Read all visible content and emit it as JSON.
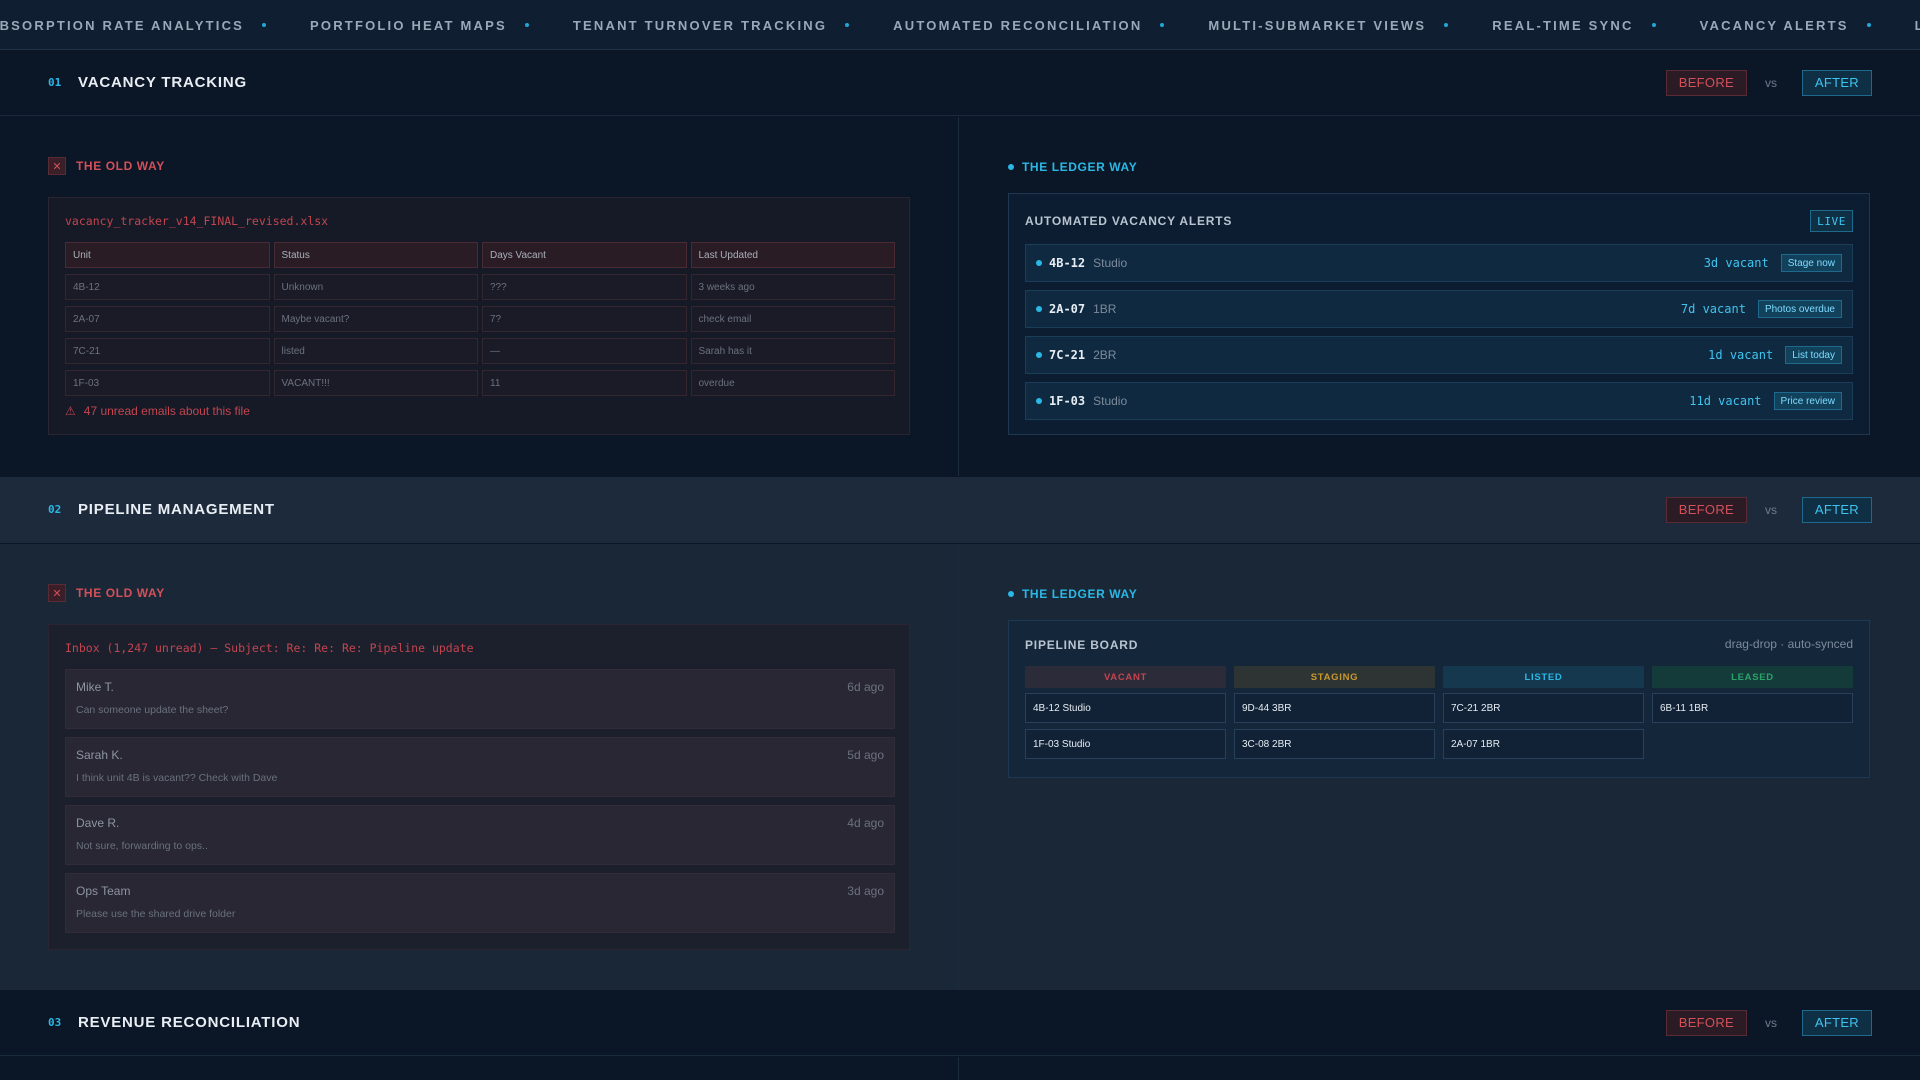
{
  "ticker": [
    "Absorption Rate Analytics",
    "Portfolio Heat Maps",
    "Tenant Turnover Tracking",
    "Automated Reconciliation",
    "Multi-Submarket Views",
    "Real-Time Sync",
    "Vacancy Alerts",
    "Lease Expiration"
  ],
  "sections": [
    {
      "num": "01",
      "title": "Vacancy Tracking",
      "before_label": "BEFORE",
      "vs_label": "vs",
      "after_label": "AFTER",
      "old_label": "The Old Way",
      "ledger_label": "The Ledger Way",
      "spreadsheet": {
        "filename": "vacancy_tracker_v14_FINAL_revised.xlsx",
        "headers": [
          "Unit",
          "Status",
          "Days Vacant",
          "Last Updated"
        ],
        "rows": [
          [
            "4B-12",
            "Unknown",
            "???",
            "3 weeks ago"
          ],
          [
            "2A-07",
            "Maybe vacant?",
            "7?",
            "check email"
          ],
          [
            "7C-21",
            "listed",
            "—",
            "Sarah has it"
          ],
          [
            "1F-03",
            "VACANT!!!",
            "11",
            "overdue"
          ]
        ],
        "warning": "47 unread emails about this file"
      },
      "alerts": {
        "title": "Automated Vacancy Alerts",
        "badge": "LIVE",
        "rows": [
          {
            "unit": "4B-12",
            "type": "Studio",
            "days": "3d vacant",
            "action": "Stage now"
          },
          {
            "unit": "2A-07",
            "type": "1BR",
            "days": "7d vacant",
            "action": "Photos overdue"
          },
          {
            "unit": "7C-21",
            "type": "2BR",
            "days": "1d vacant",
            "action": "List today"
          },
          {
            "unit": "1F-03",
            "type": "Studio",
            "days": "11d vacant",
            "action": "Price review"
          }
        ]
      }
    },
    {
      "num": "02",
      "title": "Pipeline Management",
      "before_label": "BEFORE",
      "vs_label": "vs",
      "after_label": "AFTER",
      "old_label": "The Old Way",
      "ledger_label": "The Ledger Way",
      "inbox": {
        "subject": "Inbox (1,247 unread) — Subject: Re: Re: Re: Pipeline update",
        "emails": [
          {
            "from": "Mike T.",
            "time": "6d ago",
            "body": "Can someone update the sheet?"
          },
          {
            "from": "Sarah K.",
            "time": "5d ago",
            "body": "I think unit 4B is vacant?? Check with Dave"
          },
          {
            "from": "Dave R.",
            "time": "4d ago",
            "body": "Not sure, forwarding to ops.."
          },
          {
            "from": "Ops Team",
            "time": "3d ago",
            "body": "Please use the shared drive folder"
          }
        ]
      },
      "board": {
        "title": "Pipeline Board",
        "meta": "drag-drop · auto-synced",
        "columns": [
          {
            "name": "Vacant",
            "color": "#c2454f",
            "bg": "#2b2b3a",
            "cards": [
              "4B-12 Studio",
              "1F-03 Studio"
            ]
          },
          {
            "name": "Staging",
            "color": "#c89a2e",
            "bg": "#2e3434",
            "cards": [
              "9D-44 3BR",
              "3C-08 2BR"
            ]
          },
          {
            "name": "Listed",
            "color": "#2bb8e6",
            "bg": "#15384f",
            "cards": [
              "7C-21 2BR",
              "2A-07 1BR"
            ]
          },
          {
            "name": "Leased",
            "color": "#2aa36b",
            "bg": "#153a3a",
            "cards": [
              "6B-11 1BR"
            ]
          }
        ]
      }
    },
    {
      "num": "03",
      "title": "Revenue Reconciliation",
      "before_label": "BEFORE",
      "vs_label": "vs",
      "after_label": "AFTER"
    }
  ],
  "colors": {
    "accent": "#2bb8e6",
    "danger": "#d3505a",
    "background": "#0b1626"
  }
}
